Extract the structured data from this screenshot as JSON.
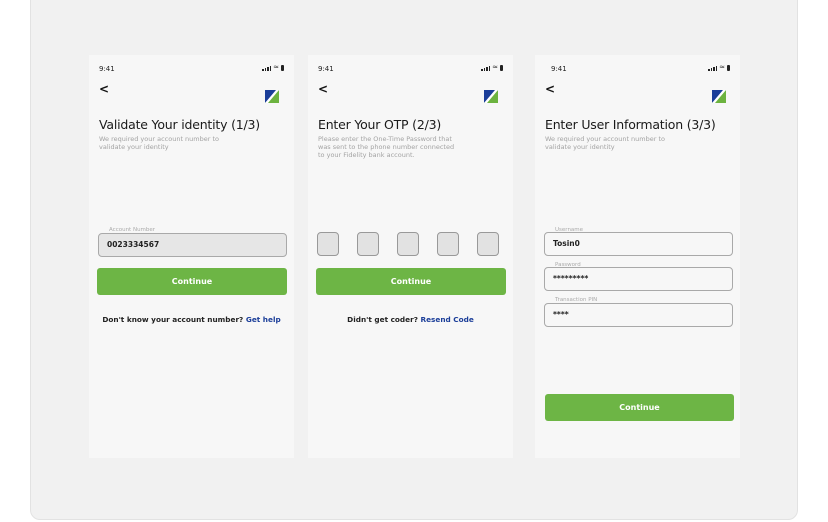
{
  "status_bar": {
    "time": "9:41"
  },
  "nav": {
    "back_glyph": "<"
  },
  "brand": {
    "logo_colors": {
      "blue": "#1b3e99",
      "green": "#6cb33f"
    }
  },
  "colors": {
    "primary_button": "#6db545",
    "link": "#1b3e99"
  },
  "screen1": {
    "title": "Validate Your identity (1/3)",
    "subtitle_lines": [
      "We required your account number to",
      "validate your identity"
    ],
    "account_label": "Account Number",
    "account_value": "0023334567",
    "button": "Continue",
    "footer_text": "Don't know your account number?",
    "footer_link": "Get help"
  },
  "screen2": {
    "title": "Enter Your OTP (2/3)",
    "subtitle_lines": [
      "Please enter the One-Time Password that",
      "was sent to the phone number connected",
      "to your Fidelity bank account."
    ],
    "otp_boxes": [
      "",
      "",
      "",
      "",
      ""
    ],
    "button": "Continue",
    "footer_text": "Didn't get coder?",
    "footer_link": "Resend Code"
  },
  "screen3": {
    "title": "Enter User Information (3/3)",
    "subtitle_lines": [
      "We required your account number to",
      "validate your identity"
    ],
    "username_label": "Username",
    "username_value": "Tosin0",
    "password_label": "Password",
    "password_value": "*********",
    "pin_label": "Transaction PIN",
    "pin_value": "****",
    "button": "Continue"
  }
}
